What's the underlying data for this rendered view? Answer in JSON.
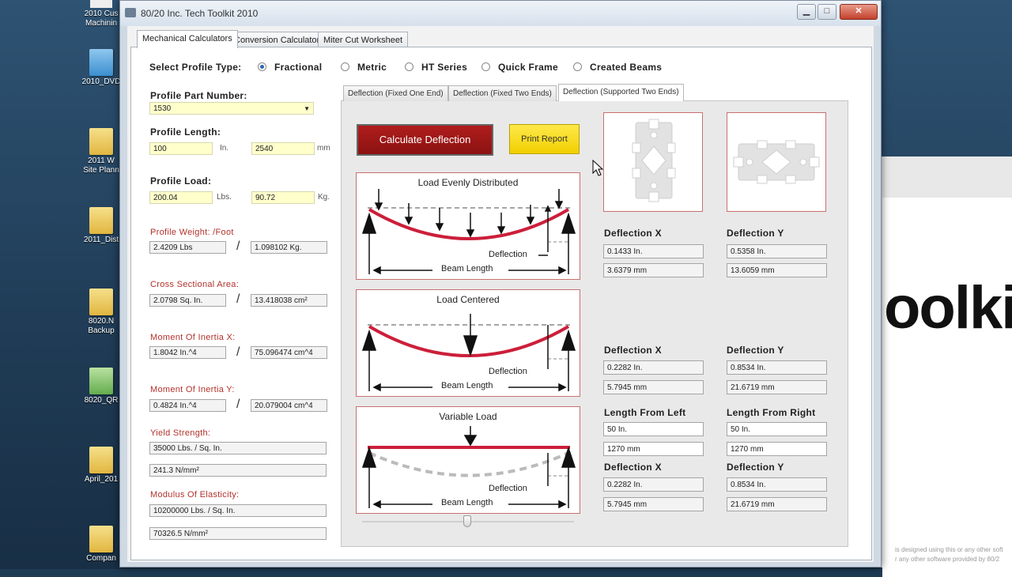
{
  "desktop": {
    "icons": [
      {
        "label": "2010 Cus\nMachinin",
        "kind": "doc"
      },
      {
        "label": "2010_DVD",
        "kind": "dvd"
      },
      {
        "label": "2011 W\nSite Plann",
        "kind": "folder"
      },
      {
        "label": "2011_Dist",
        "kind": "folder"
      },
      {
        "label": "8020.N\nBackup",
        "kind": "folder"
      },
      {
        "label": "8020_QR",
        "kind": "qr"
      },
      {
        "label": "April_201",
        "kind": "folder"
      },
      {
        "label": "Compan",
        "kind": "folder"
      }
    ],
    "background_window": {
      "big_text": "oolki",
      "fine_print": [
        "is designed using this or any other soft",
        "r any other software provided by 80/2"
      ]
    }
  },
  "window": {
    "title": "80/20 Inc.  Tech Toolkit 2010",
    "controls": {
      "minimize": "▁",
      "maximize": "□",
      "close": "✕"
    }
  },
  "tabs": [
    {
      "label": "Mechanical Calculators",
      "selected": true
    },
    {
      "label": "Conversion Calculator",
      "selected": false
    },
    {
      "label": "Miter Cut Worksheet",
      "selected": false
    }
  ],
  "profile_type": {
    "label": "Select Profile Type:",
    "options": [
      {
        "label": "Fractional",
        "selected": true
      },
      {
        "label": "Metric",
        "selected": false
      },
      {
        "label": "HT Series",
        "selected": false
      },
      {
        "label": "Quick Frame",
        "selected": false
      },
      {
        "label": "Created Beams",
        "selected": false
      }
    ]
  },
  "left": {
    "part_number": {
      "label": "Profile Part Number:",
      "value": "1530",
      "arrow": "▼"
    },
    "length": {
      "label": "Profile Length:",
      "in_value": "100",
      "in_unit": "In.",
      "mm_value": "2540",
      "mm_unit": "mm"
    },
    "load": {
      "label": "Profile Load:",
      "lbs_value": "200.04",
      "lbs_unit": "Lbs.",
      "kg_value": "90.72",
      "kg_unit": "Kg."
    },
    "weight": {
      "label": "Profile Weight: /Foot",
      "a": "2.4209 Lbs",
      "b": "1.098102 Kg."
    },
    "area": {
      "label": "Cross Sectional Area:",
      "a": "2.0798 Sq. In.",
      "b": "13.418038 cm²"
    },
    "inertia_x": {
      "label": "Moment Of Inertia X:",
      "a": "1.8042 In.^4",
      "b": "75.096474 cm^4"
    },
    "inertia_y": {
      "label": "Moment Of Inertia Y:",
      "a": "0.4824 In.^4",
      "b": "20.079004 cm^4"
    },
    "yield": {
      "label": "Yield Strength:",
      "a": "35000 Lbs. / Sq. In.",
      "b": "241.3 N/mm²"
    },
    "elasticity": {
      "label": "Modulus Of Elasticity:",
      "a": "10200000 Lbs. / Sq. In.",
      "b": "70326.5 N/mm²"
    },
    "slash": "/"
  },
  "subtabs": [
    {
      "label": "Deflection (Fixed One End)",
      "selected": false
    },
    {
      "label": "Deflection (Fixed Two Ends)",
      "selected": false
    },
    {
      "label": "Deflection (Supported Two Ends)",
      "selected": true
    }
  ],
  "buttons": {
    "calculate": "Calculate Deflection",
    "print": "Print Report"
  },
  "diagrams": [
    {
      "title": "Load Evenly Distributed",
      "deflection_label": "Deflection",
      "length_label": "Beam Length"
    },
    {
      "title": "Load Centered",
      "deflection_label": "Deflection",
      "length_label": "Beam Length"
    },
    {
      "title": "Variable Load",
      "deflection_label": "Deflection",
      "length_label": "Beam Length"
    }
  ],
  "results": {
    "evenly": {
      "x_label": "Deflection X",
      "y_label": "Deflection Y",
      "x_in": "0.1433 In.",
      "x_mm": "3.6379 mm",
      "y_in": "0.5358 In.",
      "y_mm": "13.6059 mm"
    },
    "centered": {
      "x_label": "Deflection X",
      "y_label": "Deflection Y",
      "x_in": "0.2282 In.",
      "x_mm": "5.7945 mm",
      "y_in": "0.8534 In.",
      "y_mm": "21.6719 mm"
    },
    "variable": {
      "left_label": "Length From Left",
      "right_label": "Length From Right",
      "left_in": "50 In.",
      "left_mm": "1270 mm",
      "right_in": "50 In.",
      "right_mm": "1270 mm",
      "x_label": "Deflection X",
      "y_label": "Deflection Y",
      "x_in": "0.2282 In.",
      "x_mm": "5.7945 mm",
      "y_in": "0.8534 In.",
      "y_mm": "21.6719 mm"
    }
  },
  "colors": {
    "accent_red": "#b01d1d",
    "beam_red": "#cc1f3a",
    "input_yellow": "#ffffcc",
    "print_yellow": "#ffe94a"
  }
}
